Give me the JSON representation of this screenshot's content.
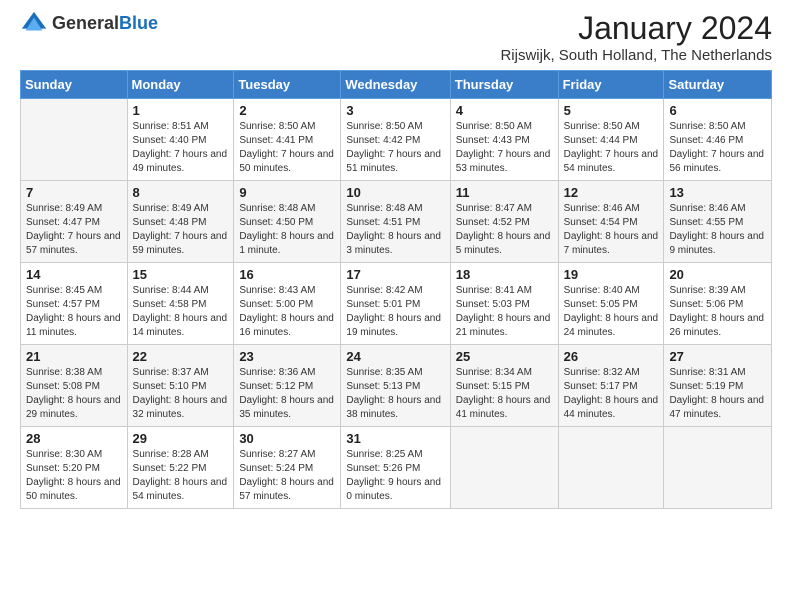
{
  "header": {
    "logo_general": "General",
    "logo_blue": "Blue",
    "month_title": "January 2024",
    "subtitle": "Rijswijk, South Holland, The Netherlands"
  },
  "weekdays": [
    "Sunday",
    "Monday",
    "Tuesday",
    "Wednesday",
    "Thursday",
    "Friday",
    "Saturday"
  ],
  "weeks": [
    [
      {
        "day": "",
        "sunrise": "",
        "sunset": "",
        "daylight": ""
      },
      {
        "day": "1",
        "sunrise": "Sunrise: 8:51 AM",
        "sunset": "Sunset: 4:40 PM",
        "daylight": "Daylight: 7 hours and 49 minutes."
      },
      {
        "day": "2",
        "sunrise": "Sunrise: 8:50 AM",
        "sunset": "Sunset: 4:41 PM",
        "daylight": "Daylight: 7 hours and 50 minutes."
      },
      {
        "day": "3",
        "sunrise": "Sunrise: 8:50 AM",
        "sunset": "Sunset: 4:42 PM",
        "daylight": "Daylight: 7 hours and 51 minutes."
      },
      {
        "day": "4",
        "sunrise": "Sunrise: 8:50 AM",
        "sunset": "Sunset: 4:43 PM",
        "daylight": "Daylight: 7 hours and 53 minutes."
      },
      {
        "day": "5",
        "sunrise": "Sunrise: 8:50 AM",
        "sunset": "Sunset: 4:44 PM",
        "daylight": "Daylight: 7 hours and 54 minutes."
      },
      {
        "day": "6",
        "sunrise": "Sunrise: 8:50 AM",
        "sunset": "Sunset: 4:46 PM",
        "daylight": "Daylight: 7 hours and 56 minutes."
      }
    ],
    [
      {
        "day": "7",
        "sunrise": "Sunrise: 8:49 AM",
        "sunset": "Sunset: 4:47 PM",
        "daylight": "Daylight: 7 hours and 57 minutes."
      },
      {
        "day": "8",
        "sunrise": "Sunrise: 8:49 AM",
        "sunset": "Sunset: 4:48 PM",
        "daylight": "Daylight: 7 hours and 59 minutes."
      },
      {
        "day": "9",
        "sunrise": "Sunrise: 8:48 AM",
        "sunset": "Sunset: 4:50 PM",
        "daylight": "Daylight: 8 hours and 1 minute."
      },
      {
        "day": "10",
        "sunrise": "Sunrise: 8:48 AM",
        "sunset": "Sunset: 4:51 PM",
        "daylight": "Daylight: 8 hours and 3 minutes."
      },
      {
        "day": "11",
        "sunrise": "Sunrise: 8:47 AM",
        "sunset": "Sunset: 4:52 PM",
        "daylight": "Daylight: 8 hours and 5 minutes."
      },
      {
        "day": "12",
        "sunrise": "Sunrise: 8:46 AM",
        "sunset": "Sunset: 4:54 PM",
        "daylight": "Daylight: 8 hours and 7 minutes."
      },
      {
        "day": "13",
        "sunrise": "Sunrise: 8:46 AM",
        "sunset": "Sunset: 4:55 PM",
        "daylight": "Daylight: 8 hours and 9 minutes."
      }
    ],
    [
      {
        "day": "14",
        "sunrise": "Sunrise: 8:45 AM",
        "sunset": "Sunset: 4:57 PM",
        "daylight": "Daylight: 8 hours and 11 minutes."
      },
      {
        "day": "15",
        "sunrise": "Sunrise: 8:44 AM",
        "sunset": "Sunset: 4:58 PM",
        "daylight": "Daylight: 8 hours and 14 minutes."
      },
      {
        "day": "16",
        "sunrise": "Sunrise: 8:43 AM",
        "sunset": "Sunset: 5:00 PM",
        "daylight": "Daylight: 8 hours and 16 minutes."
      },
      {
        "day": "17",
        "sunrise": "Sunrise: 8:42 AM",
        "sunset": "Sunset: 5:01 PM",
        "daylight": "Daylight: 8 hours and 19 minutes."
      },
      {
        "day": "18",
        "sunrise": "Sunrise: 8:41 AM",
        "sunset": "Sunset: 5:03 PM",
        "daylight": "Daylight: 8 hours and 21 minutes."
      },
      {
        "day": "19",
        "sunrise": "Sunrise: 8:40 AM",
        "sunset": "Sunset: 5:05 PM",
        "daylight": "Daylight: 8 hours and 24 minutes."
      },
      {
        "day": "20",
        "sunrise": "Sunrise: 8:39 AM",
        "sunset": "Sunset: 5:06 PM",
        "daylight": "Daylight: 8 hours and 26 minutes."
      }
    ],
    [
      {
        "day": "21",
        "sunrise": "Sunrise: 8:38 AM",
        "sunset": "Sunset: 5:08 PM",
        "daylight": "Daylight: 8 hours and 29 minutes."
      },
      {
        "day": "22",
        "sunrise": "Sunrise: 8:37 AM",
        "sunset": "Sunset: 5:10 PM",
        "daylight": "Daylight: 8 hours and 32 minutes."
      },
      {
        "day": "23",
        "sunrise": "Sunrise: 8:36 AM",
        "sunset": "Sunset: 5:12 PM",
        "daylight": "Daylight: 8 hours and 35 minutes."
      },
      {
        "day": "24",
        "sunrise": "Sunrise: 8:35 AM",
        "sunset": "Sunset: 5:13 PM",
        "daylight": "Daylight: 8 hours and 38 minutes."
      },
      {
        "day": "25",
        "sunrise": "Sunrise: 8:34 AM",
        "sunset": "Sunset: 5:15 PM",
        "daylight": "Daylight: 8 hours and 41 minutes."
      },
      {
        "day": "26",
        "sunrise": "Sunrise: 8:32 AM",
        "sunset": "Sunset: 5:17 PM",
        "daylight": "Daylight: 8 hours and 44 minutes."
      },
      {
        "day": "27",
        "sunrise": "Sunrise: 8:31 AM",
        "sunset": "Sunset: 5:19 PM",
        "daylight": "Daylight: 8 hours and 47 minutes."
      }
    ],
    [
      {
        "day": "28",
        "sunrise": "Sunrise: 8:30 AM",
        "sunset": "Sunset: 5:20 PM",
        "daylight": "Daylight: 8 hours and 50 minutes."
      },
      {
        "day": "29",
        "sunrise": "Sunrise: 8:28 AM",
        "sunset": "Sunset: 5:22 PM",
        "daylight": "Daylight: 8 hours and 54 minutes."
      },
      {
        "day": "30",
        "sunrise": "Sunrise: 8:27 AM",
        "sunset": "Sunset: 5:24 PM",
        "daylight": "Daylight: 8 hours and 57 minutes."
      },
      {
        "day": "31",
        "sunrise": "Sunrise: 8:25 AM",
        "sunset": "Sunset: 5:26 PM",
        "daylight": "Daylight: 9 hours and 0 minutes."
      },
      {
        "day": "",
        "sunrise": "",
        "sunset": "",
        "daylight": ""
      },
      {
        "day": "",
        "sunrise": "",
        "sunset": "",
        "daylight": ""
      },
      {
        "day": "",
        "sunrise": "",
        "sunset": "",
        "daylight": ""
      }
    ]
  ]
}
